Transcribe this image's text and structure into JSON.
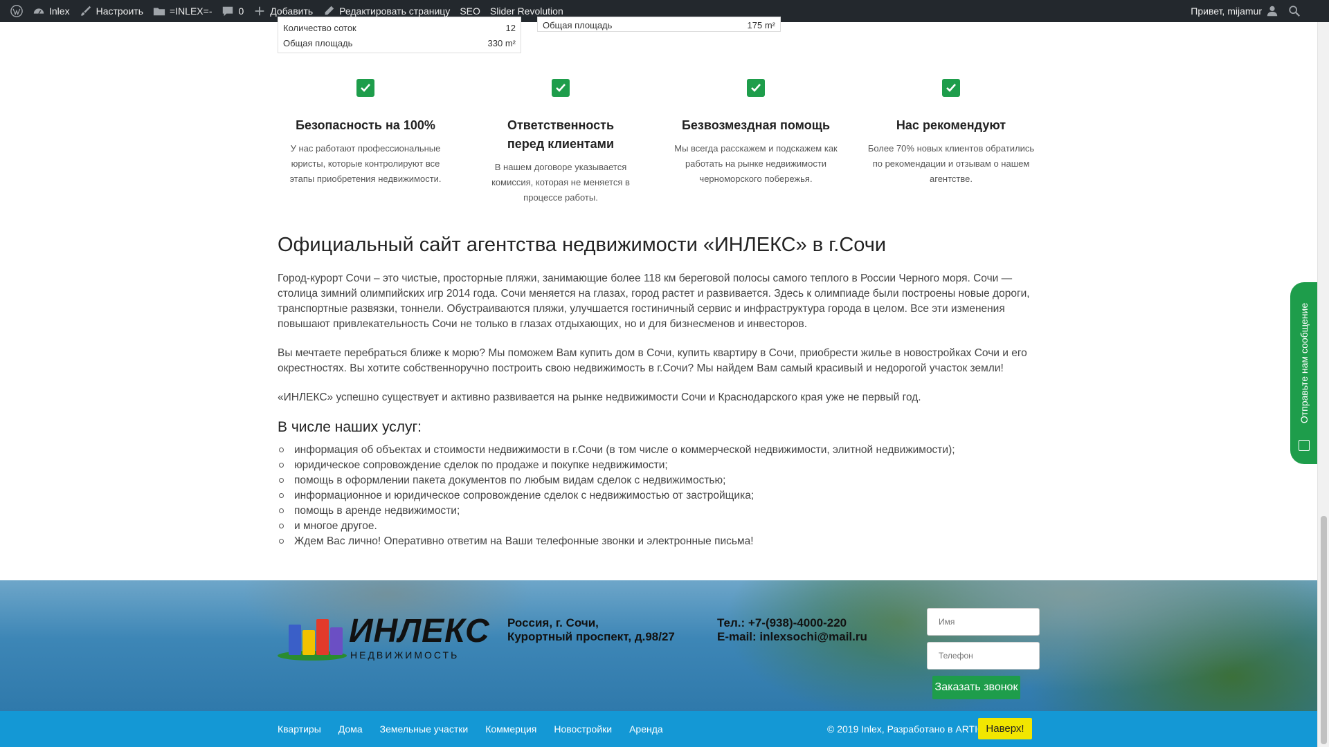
{
  "adminbar": {
    "site": "Inlex",
    "customize": "Настроить",
    "folder": "=INLEX=-",
    "comments": "0",
    "add": "Добавить",
    "edit": "Редактировать страницу",
    "seo": "SEO",
    "slider": "Slider Revolution",
    "greeting": "Привет, mijamur"
  },
  "props": [
    {
      "rows": [
        {
          "label": "Количество соток",
          "value": "12"
        },
        {
          "label": "Общая площадь",
          "value": "330 m²"
        }
      ]
    },
    {
      "rows": [
        {
          "label": "Общая площадь",
          "value": "175 m²"
        }
      ]
    }
  ],
  "features": [
    {
      "title": "Безопасность на 100%",
      "text": "У нас работают профессиональные юристы, которые контролируют все этапы приобретения недвижимости."
    },
    {
      "title": "Ответственность перед клиентами",
      "text": "В нашем договоре указывается комиссия, которая не меняется в процессе работы."
    },
    {
      "title": "Безвозмездная помощь",
      "text": "Мы всегда расскажем и подскажем как работать на рынке недвижимости черноморского побережья."
    },
    {
      "title": "Нас рекомендуют",
      "text": "Более 70% новых клиентов обратились по рекомендации и отзывам о нашем агентстве."
    }
  ],
  "article": {
    "title": "Официальный сайт агентства недвижимости «ИНЛЕКС» в г.Сочи",
    "p1": "Город-курорт Сочи – это чистые, просторные пляжи, занимающие более 118 км береговой полосы самого теплого в России Черного моря. Сочи — столица зимний олимпийских игр 2014 года. Сочи меняется на глазах, город растет и развивается. Здесь к олимпиаде были построены новые дороги, транспортные развязки, тоннели. Обустраиваются пляжи, улучшается гостиничный сервис и инфраструктура города в целом. Все эти изменения повышают привлекательность Сочи не только в глазах отдыхающих, но и для бизнесменов и инвесторов.",
    "p2": "Вы мечтаете перебраться ближе к морю? Мы поможем Вам купить дом в Сочи, купить квартиру в Сочи, приобрести жилье в новостройках Сочи и его окрестностях. Вы хотите собственноручно построить свою недвижимость в г.Сочи? Мы найдем Вам самый красивый и недорогой участок земли!",
    "p3": "«ИНЛЕКС» успешно существует и активно развивается на рынке недвижимости Сочи и Краснодарского края уже не первый год.",
    "services_title": "В числе наших услуг:",
    "services": [
      "информация об объектах и стоимости недвижимости в г.Сочи (в том числе о коммерческой недвижимости, элитной недвижимости);",
      "юридическое сопровождение сделок по продаже и покупке недвижимости;",
      "помощь в оформлении пакета документов по любым видам сделок с недвижимостью;",
      "информационное и юридическое сопровождение сделок с недвижимостью от застройщика;",
      "помощь в аренде недвижимости;",
      "и многое другое.",
      "Ждем Вас лично! Оперативно ответим на Ваши телефонные звонки и электронные письма!"
    ]
  },
  "footer": {
    "logo_text": "ИНЛЕКС",
    "logo_sub": "НЕДВИЖИМОСТЬ",
    "address_1": "Россия, г. Сочи,",
    "address_2": "Курортный проспект, д.98/27",
    "phone": "Тел.: +7-(938)-4000-220",
    "email": "E-mail: inlexsochi@mail.ru",
    "name_placeholder": "Имя",
    "phone_placeholder": "Телефон",
    "call_button": "Заказать звонок"
  },
  "bottom": {
    "menu": [
      "Квартиры",
      "Дома",
      "Земельные участки",
      "Коммерция",
      "Новостройки",
      "Аренда"
    ],
    "copyright": "© 2019 Inlex, Разработано в ARTIQA",
    "top_button": "Наверх!"
  },
  "sidetab": {
    "label": "Отправьте нам сообщение"
  },
  "colors": {
    "accent_green": "#1e9d4b",
    "footer_blue": "#1498d5",
    "top_button": "#f2e600"
  }
}
